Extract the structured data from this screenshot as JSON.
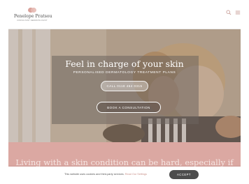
{
  "header": {
    "logo_name": "Penelope Pratsou",
    "logo_sub": "CONSULTANT DERMATOLOGIST",
    "icons": [
      "search-icon",
      "menu-icon"
    ]
  },
  "hero": {
    "title": "Feel in charge of your skin",
    "subtitle": "PERSONALISED DERMATOLOGY TREATMENT PLANS",
    "call_button": "CALL 0118 464 0315",
    "book_button": "BOOK A CONSULTATION"
  },
  "band": {
    "text": "Living with a skin condition can be hard, especially if"
  },
  "cookie": {
    "text": "This website uses cookies and third-party services.",
    "link": "Read Our Settings",
    "accept": "ACCEPT"
  },
  "colors": {
    "accent_pink": "#dba8a2",
    "logo_pink": "#d9a29b",
    "button_dark": "#4c4c4c"
  }
}
